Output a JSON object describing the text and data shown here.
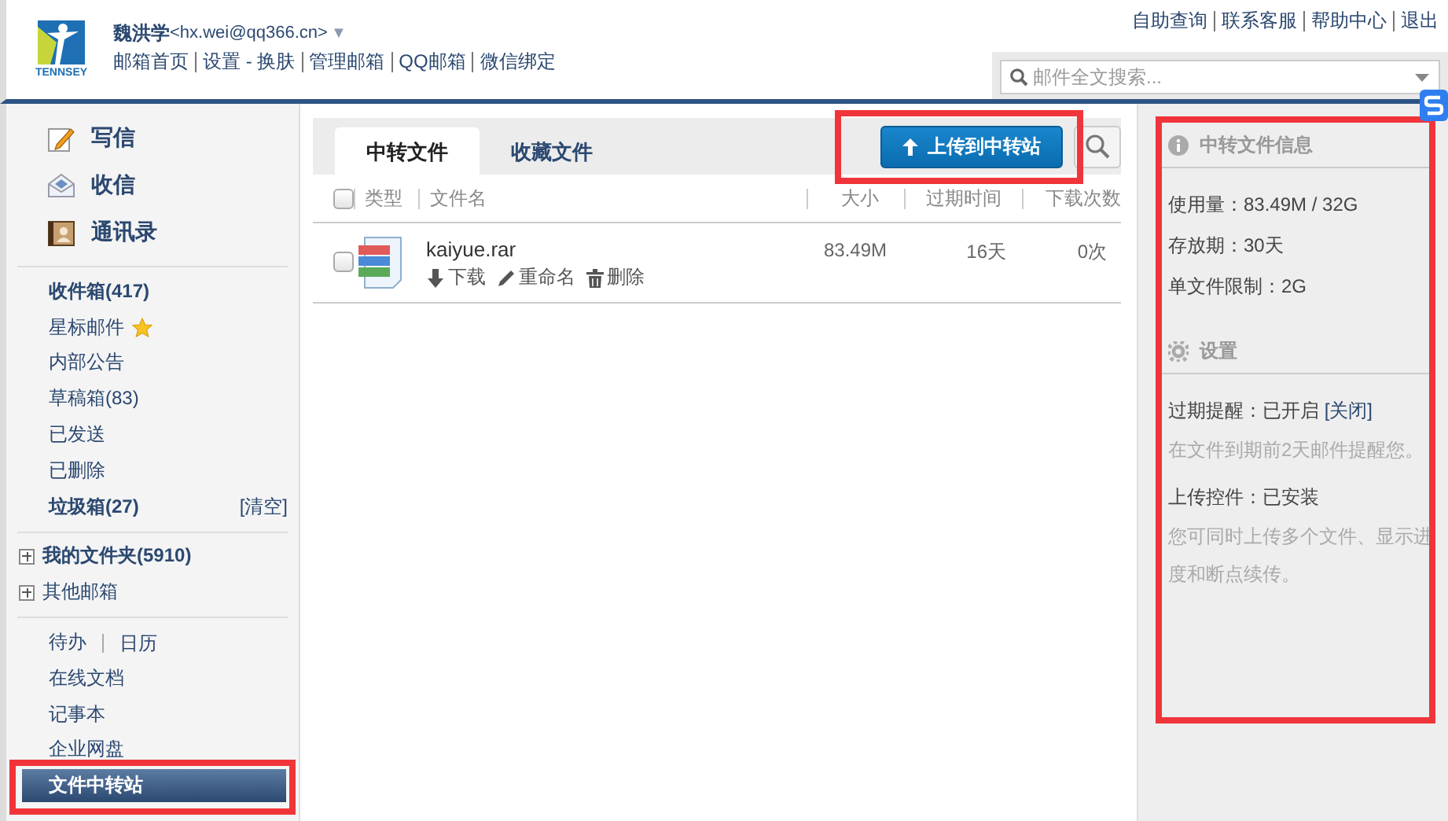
{
  "header": {
    "logo_text": "TENNSEY",
    "user_name": "魏洪学",
    "user_email": "<hx.wei@qq366.cn>",
    "user_menu": "▼",
    "nav_links": [
      "邮箱首页",
      "设置 - 换肤",
      "管理邮箱",
      "QQ邮箱",
      "微信绑定"
    ],
    "top_links": [
      "自助查询",
      "联系客服",
      "帮助中心",
      "退出"
    ],
    "search": {
      "placeholder": "邮件全文搜索..."
    }
  },
  "sidebar": {
    "actions": [
      {
        "label": "写信",
        "kind": "compose"
      },
      {
        "label": "收信",
        "kind": "inbox"
      },
      {
        "label": "通讯录",
        "kind": "contacts"
      }
    ],
    "folders": [
      {
        "label": "收件箱(417)",
        "bold": true,
        "starred": false
      },
      {
        "label": "星标邮件",
        "bold": false,
        "starred": true
      },
      {
        "label": "内部公告",
        "bold": false,
        "starred": false
      },
      {
        "label": "草稿箱(83)",
        "bold": false,
        "starred": false
      },
      {
        "label": "已发送",
        "bold": false,
        "starred": false
      },
      {
        "label": "已删除",
        "bold": false,
        "starred": false
      },
      {
        "label": "垃圾箱(27)",
        "bold": true,
        "starred": false,
        "action": "[清空]"
      }
    ],
    "groups": [
      {
        "label": "我的文件夹(5910)",
        "bold": true,
        "expanded": false
      },
      {
        "label": "其他邮箱",
        "bold": false,
        "expanded": false
      }
    ],
    "tools": [
      {
        "links": [
          "待办",
          "日历"
        ],
        "selected": false,
        "highlighted": false
      },
      {
        "links": [
          "在线文档"
        ],
        "selected": false,
        "highlighted": false
      },
      {
        "links": [
          "记事本"
        ],
        "selected": false,
        "highlighted": false
      },
      {
        "links": [
          "企业网盘"
        ],
        "selected": false,
        "highlighted": false
      },
      {
        "links": [
          "文件中转站"
        ],
        "selected": true,
        "highlighted": true
      }
    ]
  },
  "main": {
    "tabs": [
      {
        "label": "中转文件",
        "selected": true
      },
      {
        "label": "收藏文件",
        "selected": false
      }
    ],
    "upload_button": {
      "label": "上传到中转站",
      "highlighted": true
    },
    "table": {
      "select_all": {
        "checked": false
      },
      "columns": [
        "类型",
        "文件名",
        "大小",
        "过期时间",
        "下载次数"
      ],
      "rows": [
        {
          "checked": false,
          "name": "kaiyue.rar",
          "size": "83.49M",
          "expiry": "16天",
          "downloads": "0次",
          "actions": [
            {
              "label": "下载",
              "kind": "download"
            },
            {
              "label": "重命名",
              "kind": "rename"
            },
            {
              "label": "删除",
              "kind": "delete"
            }
          ]
        }
      ]
    }
  },
  "info_panel": {
    "highlighted": true,
    "title": "中转文件信息",
    "stats": [
      "使用量：83.49M / 32G",
      "存放期：30天",
      "单文件限制：2G"
    ],
    "settings_title": "设置",
    "settings": [
      {
        "label": "过期提醒：已开启 ",
        "link": "[关闭]",
        "note": "在文件到期前2天邮件提醒您。"
      },
      {
        "label": "上传控件：已安装",
        "note": "您可同时上传多个文件、显示进度和断点续传。"
      }
    ]
  }
}
